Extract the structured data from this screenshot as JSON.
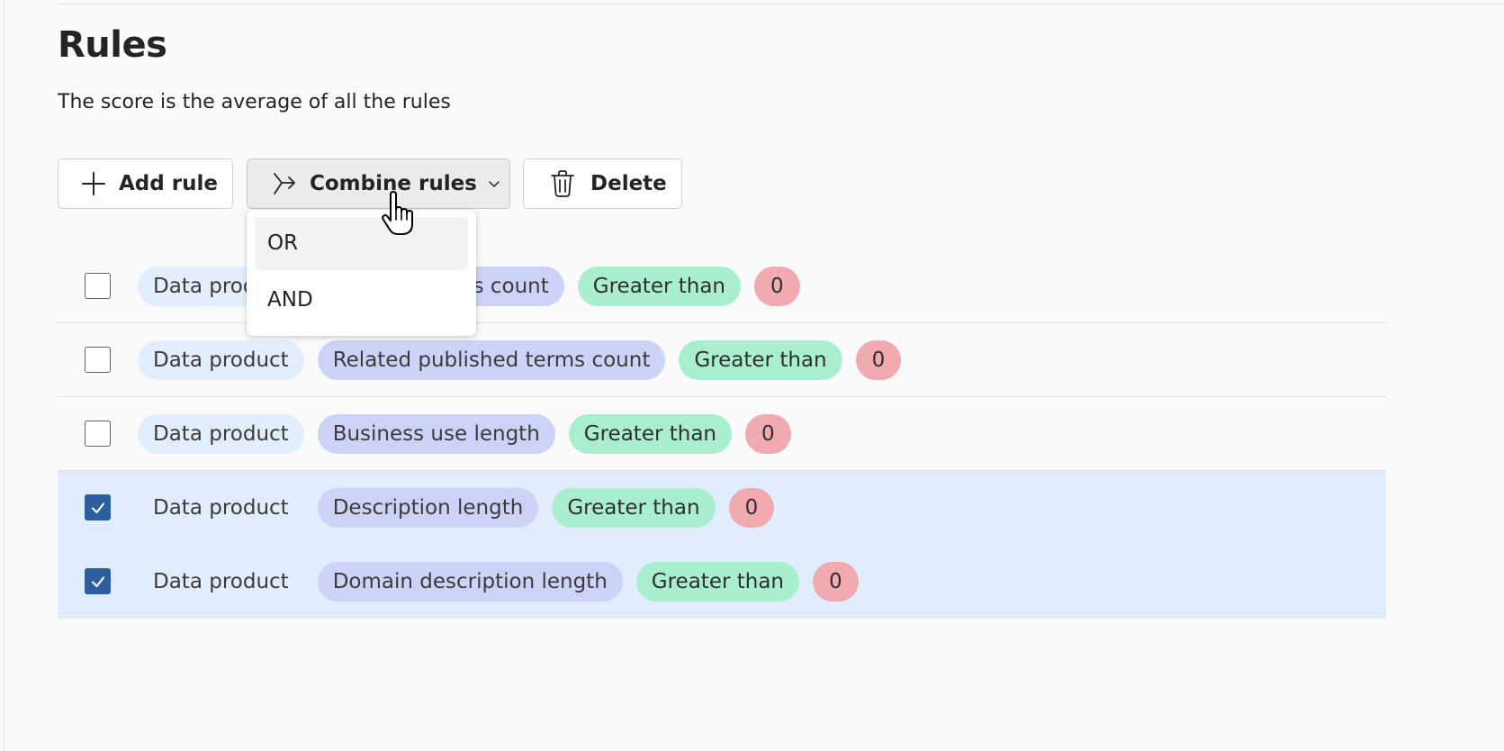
{
  "page": {
    "title": "Rules",
    "description": "The score is the average of all the rules"
  },
  "toolbar": {
    "add_rule_label": "Add rule",
    "combine_rules_label": "Combine rules",
    "delete_label": "Delete"
  },
  "combine_menu": {
    "items": [
      {
        "label": "OR",
        "hovered": true
      },
      {
        "label": "AND",
        "hovered": false
      }
    ]
  },
  "rules": [
    {
      "entity": "Data product",
      "field": "Related assets count",
      "operator": "Greater than",
      "value": "0",
      "checked": false
    },
    {
      "entity": "Data product",
      "field": "Related published terms count",
      "operator": "Greater than",
      "value": "0",
      "checked": false
    },
    {
      "entity": "Data product",
      "field": "Business use length",
      "operator": "Greater than",
      "value": "0",
      "checked": false
    },
    {
      "entity": "Data product",
      "field": "Description length",
      "operator": "Greater than",
      "value": "0",
      "checked": true
    },
    {
      "entity": "Data product",
      "field": "Domain description length",
      "operator": "Greater than",
      "value": "0",
      "checked": true
    }
  ],
  "colors": {
    "selected_row_bg": "#e1edfc",
    "checkbox_checked": "#2c5f9e",
    "entity_chip": "#e3eefd",
    "field_chip": "#cdd3f7",
    "operator_chip": "#a9efcf",
    "value_chip": "#f0aab0"
  },
  "icons": {
    "add": "plus-icon",
    "combine": "combine-arrow-icon",
    "menu": "chevron-down-icon",
    "delete": "trash-icon",
    "check": "checkmark-icon",
    "pointer": "hand-pointer-icon"
  }
}
